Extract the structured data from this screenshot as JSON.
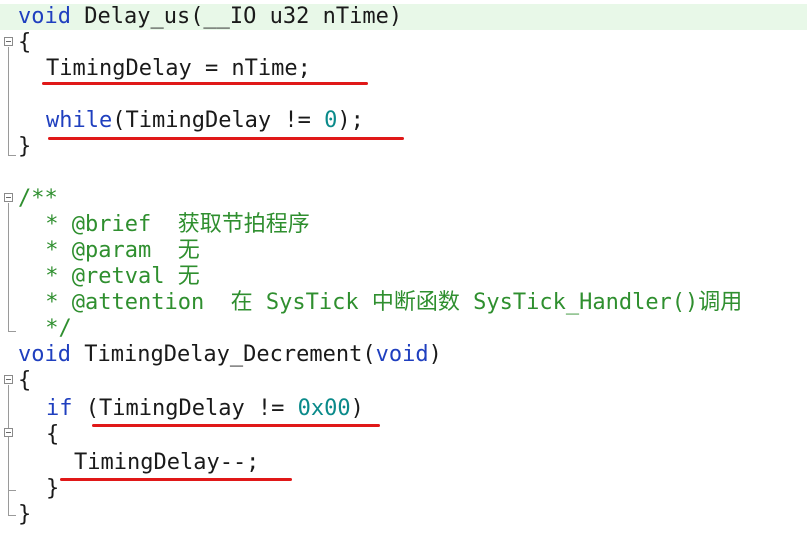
{
  "editor": {
    "line1": {
      "kw": "void",
      "rest": " Delay_us(__IO u32 nTime)"
    },
    "line2": "{",
    "line3": "TimingDelay = nTime;",
    "line4": {
      "kw": "while",
      "a": "(TimingDelay != ",
      "num": "0",
      "b": ");"
    },
    "line5": "}",
    "doc": {
      "open": "/**",
      "brief": " * @brief  获取节拍程序",
      "param": " * @param  无",
      "retval": " * @retval 无",
      "attention": " * @attention  在 SysTick 中断函数 SysTick_Handler()调用",
      "close": " */"
    },
    "line12": {
      "kw": "void",
      "a": " TimingDelay_Decrement(",
      "kw2": "void",
      "b": ")"
    },
    "line13": "{",
    "line14": {
      "kw": "if",
      "a": " (TimingDelay != ",
      "num": "0x00",
      "b": ")"
    },
    "line15": "{",
    "line16": "TimingDelay--;",
    "line17": "}",
    "line18": "}"
  },
  "colors": {
    "keyword": "#1f3fbf",
    "number": "#0a8a8a",
    "comment": "#2f8f2f",
    "current_line": "#e8f8e8",
    "annotation_underline": "#e01818"
  }
}
